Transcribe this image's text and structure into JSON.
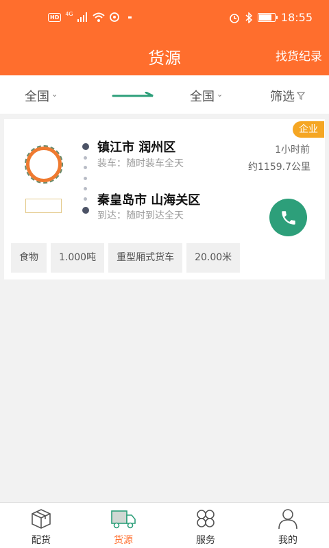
{
  "status_bar": {
    "hd": "HD",
    "network": "4G",
    "time": "18:55",
    "battery_level": 0.85
  },
  "app_bar": {
    "title": "货源",
    "history_link": "找货纪录"
  },
  "filters": {
    "from": "全国",
    "to": "全国",
    "filter_label": "筛选"
  },
  "card": {
    "badge": "企业",
    "origin_city": "镇江市  润州区",
    "loading_time": "装车：随时装车全天",
    "destination_city": "秦皇岛市  山海关区",
    "arrival_time": "到达：随时到达全天",
    "posted_ago": "1小时前",
    "distance": "约1159.7公里",
    "tags": [
      "食物",
      "1.000吨",
      "重型厢式货车",
      "20.00米"
    ]
  },
  "tabs": [
    {
      "label": "配货",
      "icon": "box-icon",
      "active": false
    },
    {
      "label": "货源",
      "icon": "truck-icon",
      "active": true
    },
    {
      "label": "服务",
      "icon": "grid-icon",
      "active": false
    },
    {
      "label": "我的",
      "icon": "user-icon",
      "active": false
    }
  ],
  "colors": {
    "brand": "#ff6e2d",
    "call_button": "#2d9f7a",
    "badge": "#f5a623",
    "route_arrow": "#2d9f7a"
  }
}
